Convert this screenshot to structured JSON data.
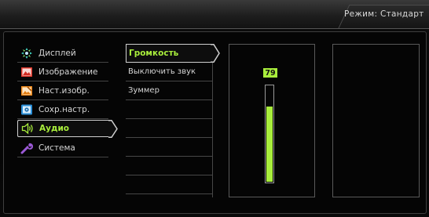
{
  "header": {
    "mode_label": "Режим: Стандарт"
  },
  "menu": {
    "items": [
      {
        "label": "Дисплей",
        "icon": "display-icon",
        "active": false
      },
      {
        "label": "Изображение",
        "icon": "picture-icon",
        "active": false
      },
      {
        "label": "Наст.изобр.",
        "icon": "picture-advanced-icon",
        "active": false
      },
      {
        "label": "Сохр.настр.",
        "icon": "save-settings-icon",
        "active": false
      },
      {
        "label": "Аудио",
        "icon": "speaker-icon",
        "active": true
      },
      {
        "label": "Система",
        "icon": "wrench-icon",
        "active": false
      }
    ]
  },
  "submenu": {
    "items": [
      {
        "label": "Громкость",
        "active": true
      },
      {
        "label": "Выключить звук",
        "active": false
      },
      {
        "label": "Зуммер",
        "active": false
      },
      {
        "label": "",
        "active": false
      },
      {
        "label": "",
        "active": false
      },
      {
        "label": "",
        "active": false
      },
      {
        "label": "",
        "active": false
      },
      {
        "label": "",
        "active": false
      }
    ]
  },
  "volume": {
    "value": "79",
    "level_percent": 79
  },
  "colors": {
    "accent": "#a9ee3c",
    "border": "#5a5a5a",
    "background": "#060606"
  }
}
